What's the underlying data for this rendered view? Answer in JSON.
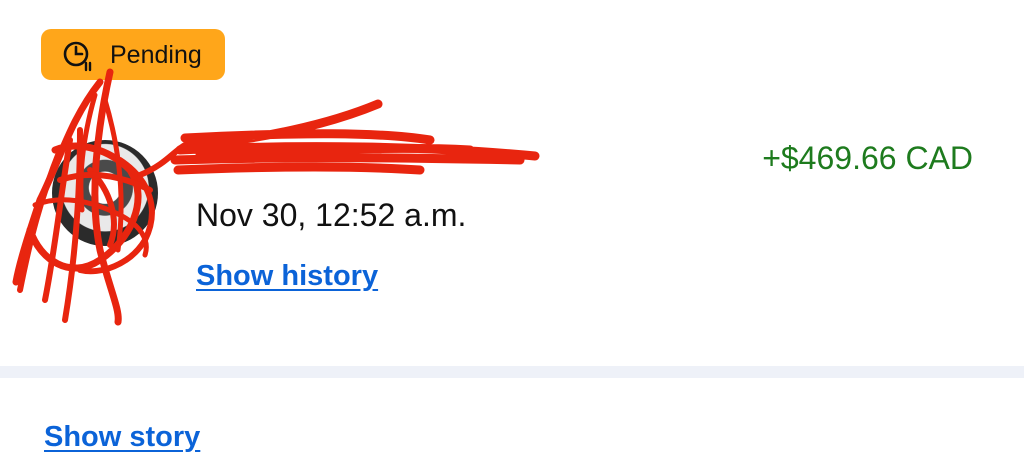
{
  "transaction": {
    "status": "Pending",
    "status_icon": "clock-icon",
    "merchant_name": "",
    "date": "Nov 30, 12:52 a.m.",
    "amount": "+$469.66 CAD",
    "show_history_label": "Show history"
  },
  "story": {
    "show_story_label": "Show story"
  },
  "colors": {
    "badge_background": "#ffa61a",
    "amount_positive": "#1e7b1e",
    "link": "#0b63d8",
    "divider": "#eef1f8",
    "redaction": "#e8250f"
  }
}
